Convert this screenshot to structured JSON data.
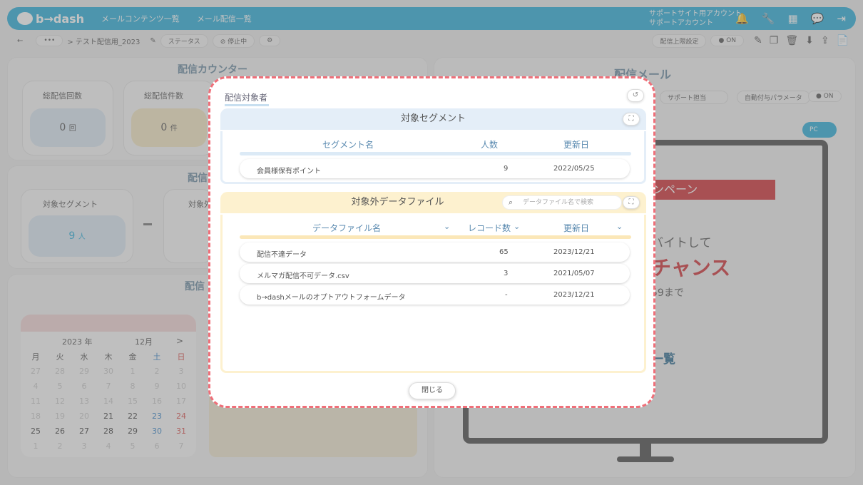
{
  "app": {
    "logo_text": "b→dash"
  },
  "topbar": {
    "nav": [
      "メールコンテンツ一覧",
      "メール配信一覧"
    ],
    "support_line1": "サポートサイト用アカウント",
    "support_line2": "サポートアカウント",
    "icons": [
      "bell-icon",
      "wrench-icon",
      "grid-icon",
      "chat-icon",
      "logout-icon"
    ]
  },
  "toolbar": {
    "back": "←",
    "more": "•••",
    "breadcrumb": "> テスト配信用_2023",
    "status_label": "ステータス",
    "stop_label": "停止中",
    "limit_label": "配信上限設定",
    "on_label": "ON"
  },
  "background": {
    "counter_title": "配信カウンター",
    "total_count_label": "総配信回数",
    "total_count_value": "0",
    "total_count_unit": "回",
    "total_items_label": "総配信件数",
    "total_items_value": "0",
    "total_items_unit": "件",
    "target_title": "配信",
    "segment_label": "対象セグメント",
    "segment_value": "9",
    "segment_unit": "人",
    "segment_label2": "対象外",
    "schedule_title": "配信",
    "mail_title": "配信メール",
    "support_label": "サポート担当",
    "auto_param_label": "自動付与パラメータ",
    "auto_on": "ON",
    "pc_toggle": "PC",
    "preview_banner": "ンペーン",
    "preview_line1": "バイトして",
    "preview_line2": "チャンス",
    "preview_line3": "59まで",
    "preview_line4": "一覧",
    "calendar": {
      "year": "2023 年",
      "month": "12月",
      "next": ">",
      "weekdays": [
        "月",
        "火",
        "水",
        "木",
        "金",
        "土",
        "日"
      ],
      "rows": [
        [
          "27",
          "28",
          "29",
          "30",
          "1",
          "2",
          "3"
        ],
        [
          "4",
          "5",
          "6",
          "7",
          "8",
          "9",
          "10"
        ],
        [
          "11",
          "12",
          "13",
          "14",
          "15",
          "16",
          "17"
        ],
        [
          "18",
          "19",
          "20",
          "21",
          "22",
          "23",
          "24"
        ],
        [
          "25",
          "26",
          "27",
          "28",
          "29",
          "30",
          "31"
        ],
        [
          "1",
          "2",
          "3",
          "4",
          "5",
          "6",
          "7"
        ]
      ]
    }
  },
  "modal": {
    "title": "配信対象者",
    "segment_section": {
      "title": "対象セグメント",
      "columns": [
        "セグメント名",
        "人数",
        "更新日"
      ],
      "rows": [
        {
          "name": "会員様保有ポイント",
          "count": "9",
          "date": "2022/05/25"
        }
      ]
    },
    "excluded_section": {
      "title": "対象外データファイル",
      "search_placeholder": "データファイル名で検索",
      "columns": [
        "データファイル名",
        "レコード数",
        "更新日"
      ],
      "rows": [
        {
          "name": "配信不達データ",
          "count": "65",
          "date": "2023/12/21"
        },
        {
          "name": "メルマガ配信不可データ.csv",
          "count": "3",
          "date": "2021/05/07"
        },
        {
          "name": "b→dashメールのオプトアウトフォームデータ",
          "count": "-",
          "date": "2023/12/21"
        }
      ]
    },
    "close_label": "閉じる"
  },
  "colors": {
    "accent": "#2aaed9",
    "modal_border": "#ef6f79",
    "segment_header": "#e4eef8",
    "excluded_header": "#fdf1cf"
  }
}
